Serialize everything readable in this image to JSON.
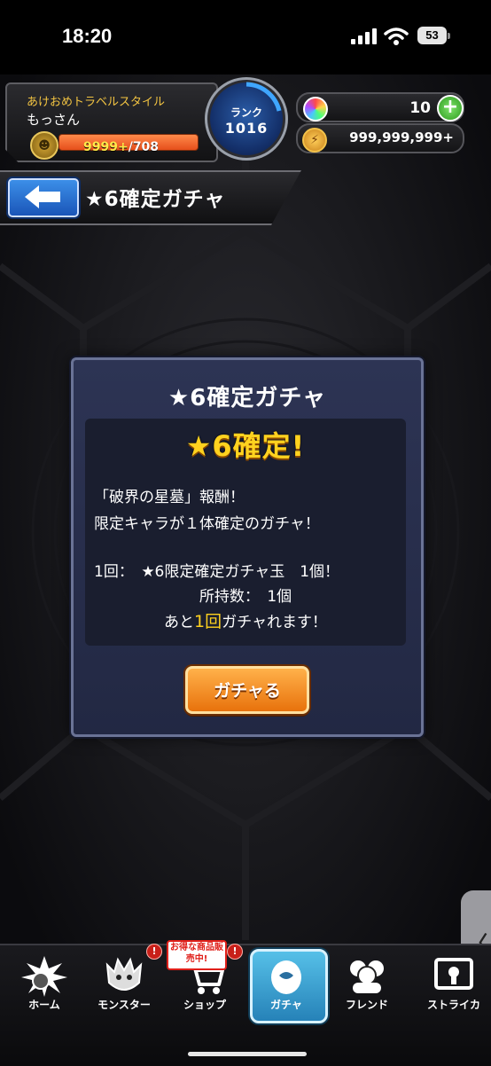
{
  "status_bar": {
    "time": "18:20",
    "battery": "53"
  },
  "player": {
    "title": "あけおめトラベルスタイル",
    "name": "もっさん",
    "stamina_current": "9999+",
    "stamina_max": "/708"
  },
  "rank": {
    "label": "ランク",
    "value": "1016"
  },
  "currency": {
    "orbs": "10",
    "gold": "999,999,999+"
  },
  "header": {
    "title": "★6確定ガチャ"
  },
  "dialog": {
    "title": "★6確定ガチャ",
    "badge": "★6確定!",
    "line1": "「破界の星墓」報酬！",
    "line2": "限定キャラが１体確定のガチャ！",
    "line3": "1回：　★6限定確定ガチャ玉　1個！",
    "line4": "所持数：　1個",
    "line5_prefix": "あと",
    "line5_count": "1回",
    "line5_suffix": "ガチャれます！",
    "button_label": "ガチャる"
  },
  "nav": {
    "items": [
      {
        "label": "ホーム",
        "icon": "home-icon"
      },
      {
        "label": "モンスター",
        "icon": "monster-icon"
      },
      {
        "label": "ショップ",
        "icon": "cart-icon"
      },
      {
        "label": "ガチャ",
        "icon": "gacha-egg-icon"
      },
      {
        "label": "フレンド",
        "icon": "friends-icon"
      },
      {
        "label": "ストライカ",
        "icon": "striker-card-icon"
      }
    ],
    "active": "ガチャ",
    "shop_sale_badge": "お得な商品販売中!",
    "alert_badge": "!"
  },
  "colors": {
    "accent_gold": "#ffd21f",
    "button_orange": "#e8720c",
    "active_tab": "#2682b8"
  }
}
